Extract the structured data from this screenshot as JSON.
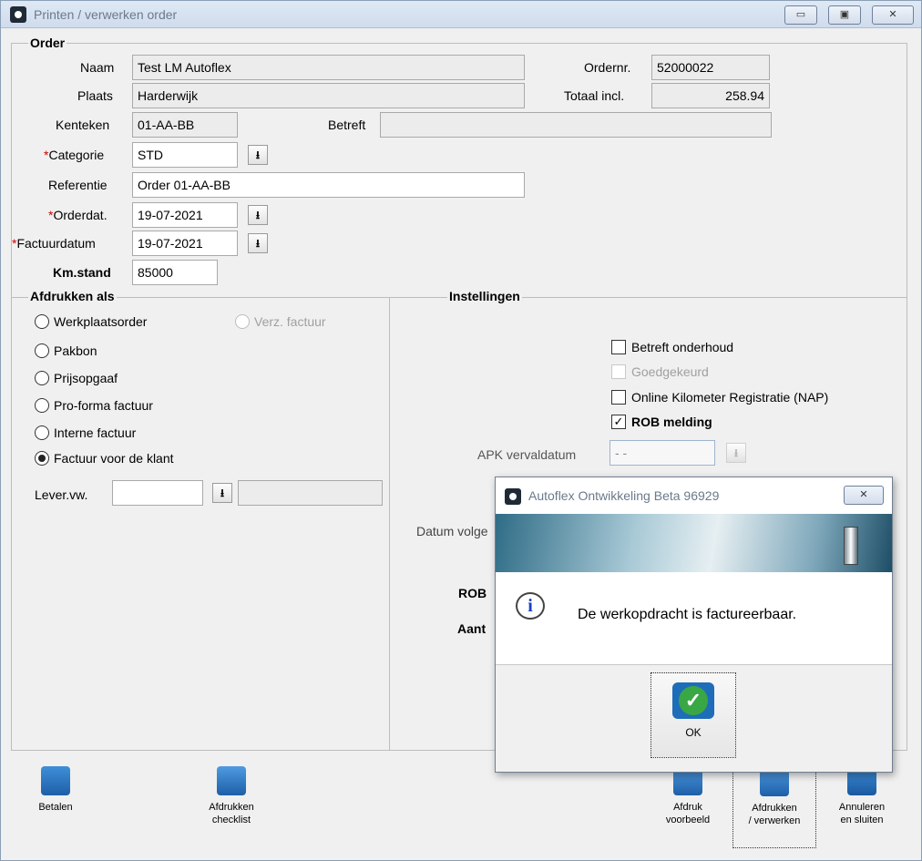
{
  "window": {
    "title": "Printen / verwerken order",
    "buttons": {
      "minimize": "▭",
      "maximize": "▣",
      "close": "✕"
    }
  },
  "order": {
    "group_title": "Order",
    "naam_label": "Naam",
    "naam": "Test LM Autoflex",
    "plaats_label": "Plaats",
    "plaats": "Harderwijk",
    "kenteken_label": "Kenteken",
    "kenteken": "01-AA-BB",
    "betreft_label": "Betreft",
    "betreft": "",
    "ordernr_label": "Ordernr.",
    "ordernr": "52000022",
    "totaal_label": "Totaal incl.",
    "totaal": "258.94",
    "categorie_label": "Categorie",
    "categorie": "STD",
    "referentie_label": "Referentie",
    "referentie": "Order 01-AA-BB",
    "orderdat_label": "Orderdat.",
    "orderdat": "19-07-2021",
    "factuurdatum_label": "Factuurdatum",
    "factuurdatum": "19-07-2021",
    "kmstand_label": "Km.stand",
    "kmstand": "85000",
    "required_mark": "*"
  },
  "afdrukken": {
    "group_title": "Afdrukken als",
    "options": [
      {
        "label": "Werkplaatsorder",
        "selected": false
      },
      {
        "label": "Pakbon",
        "selected": false
      },
      {
        "label": "Prijsopgaaf",
        "selected": false
      },
      {
        "label": "Pro-forma factuur",
        "selected": false
      },
      {
        "label": "Interne factuur",
        "selected": false
      },
      {
        "label": "Factuur voor de klant",
        "selected": true
      }
    ],
    "verz_factuur": "Verz. factuur",
    "levervw_label": "Lever.vw.",
    "levervw": ""
  },
  "instellingen": {
    "group_title": "Instellingen",
    "checks": [
      {
        "label": "Betreft onderhoud",
        "checked": false,
        "disabled": false,
        "bold": false
      },
      {
        "label": "Goedgekeurd",
        "checked": false,
        "disabled": true,
        "bold": false
      },
      {
        "label": "Online Kilometer Registratie (NAP)",
        "checked": false,
        "disabled": false,
        "bold": false
      },
      {
        "label": "ROB melding",
        "checked": true,
        "disabled": false,
        "bold": true
      }
    ],
    "apk_label": "APK vervaldatum",
    "apk_value": "-  -",
    "datum_volgend_label": "Datum volge",
    "rob_label": "ROB",
    "aant_label": "Aant"
  },
  "dialog": {
    "title": "Autoflex Ontwikkeling Beta 96929",
    "message": "De werkopdracht is factureerbaar.",
    "ok_label": "OK",
    "close_glyph": "✕",
    "info_glyph": "i"
  },
  "toolbar": {
    "betalen": "Betalen",
    "afdrukken_checklist_1": "Afdrukken",
    "afdrukken_checklist_2": "checklist",
    "afdruk_voorbeeld_1": "Afdruk",
    "afdruk_voorbeeld_2": "voorbeeld",
    "afdrukken_verwerken_1": "Afdrukken",
    "afdrukken_verwerken_2": "/ verwerken",
    "annuleren_1": "Annuleren",
    "annuleren_2": "en sluiten"
  },
  "dropdown_glyph": "⭳",
  "colors": {
    "required": "#d00000",
    "titlebar": "#cfdcec",
    "ok_green": "#3aa745",
    "icon_blue": "#1f6fc6"
  }
}
